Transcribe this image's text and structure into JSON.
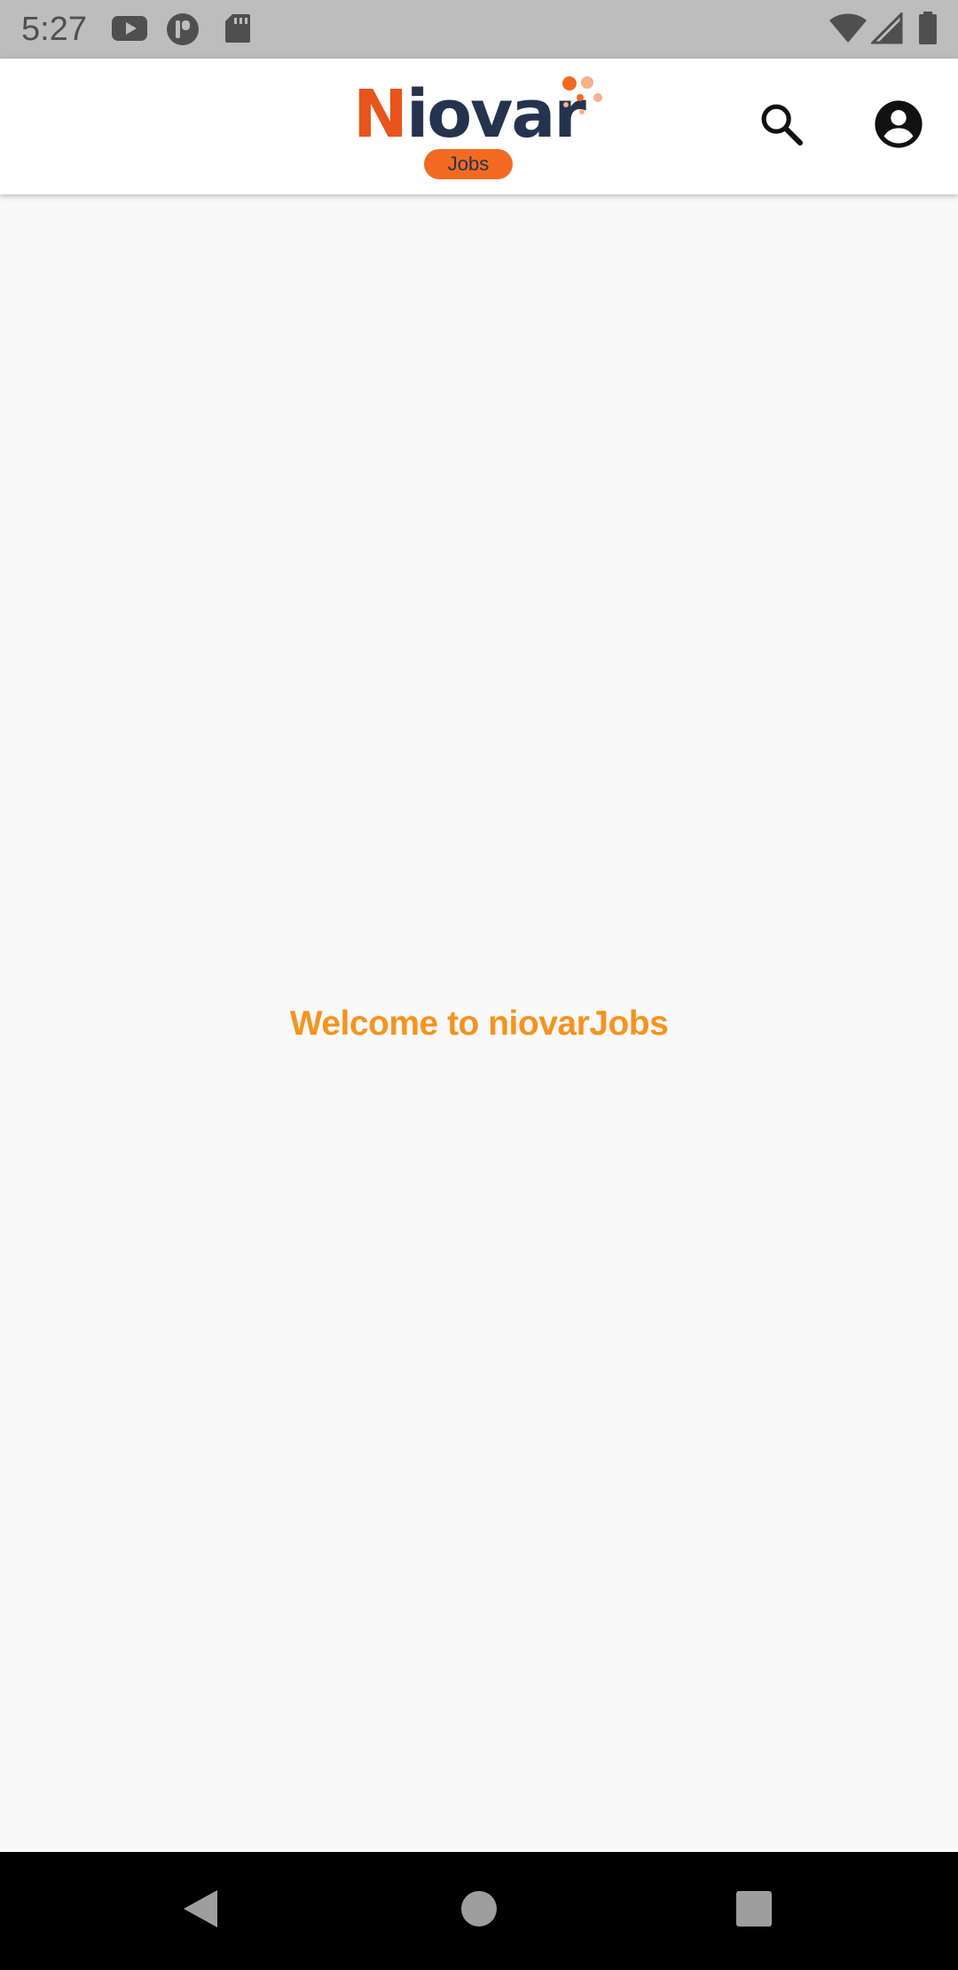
{
  "status_bar": {
    "time": "5:27",
    "left_icons": [
      "youtube-icon",
      "app-icon",
      "sd-card-icon"
    ],
    "right_icons": [
      "wifi-icon",
      "cellular-icon",
      "battery-icon"
    ]
  },
  "app_bar": {
    "logo": {
      "wordmark": "Niovar",
      "badge": "Jobs"
    },
    "actions": [
      "search-icon",
      "account-circle-icon"
    ]
  },
  "main": {
    "welcome_text": "Welcome to niovarJobs"
  },
  "nav_bar": {
    "buttons": [
      "back-icon",
      "home-icon",
      "recents-icon"
    ]
  },
  "colors": {
    "welcome": "#f6931e",
    "logo_orange": "#f26a21",
    "logo_navy": "#24344f",
    "status_bar": "#bdbdbd",
    "background": "#f9f9f9"
  }
}
